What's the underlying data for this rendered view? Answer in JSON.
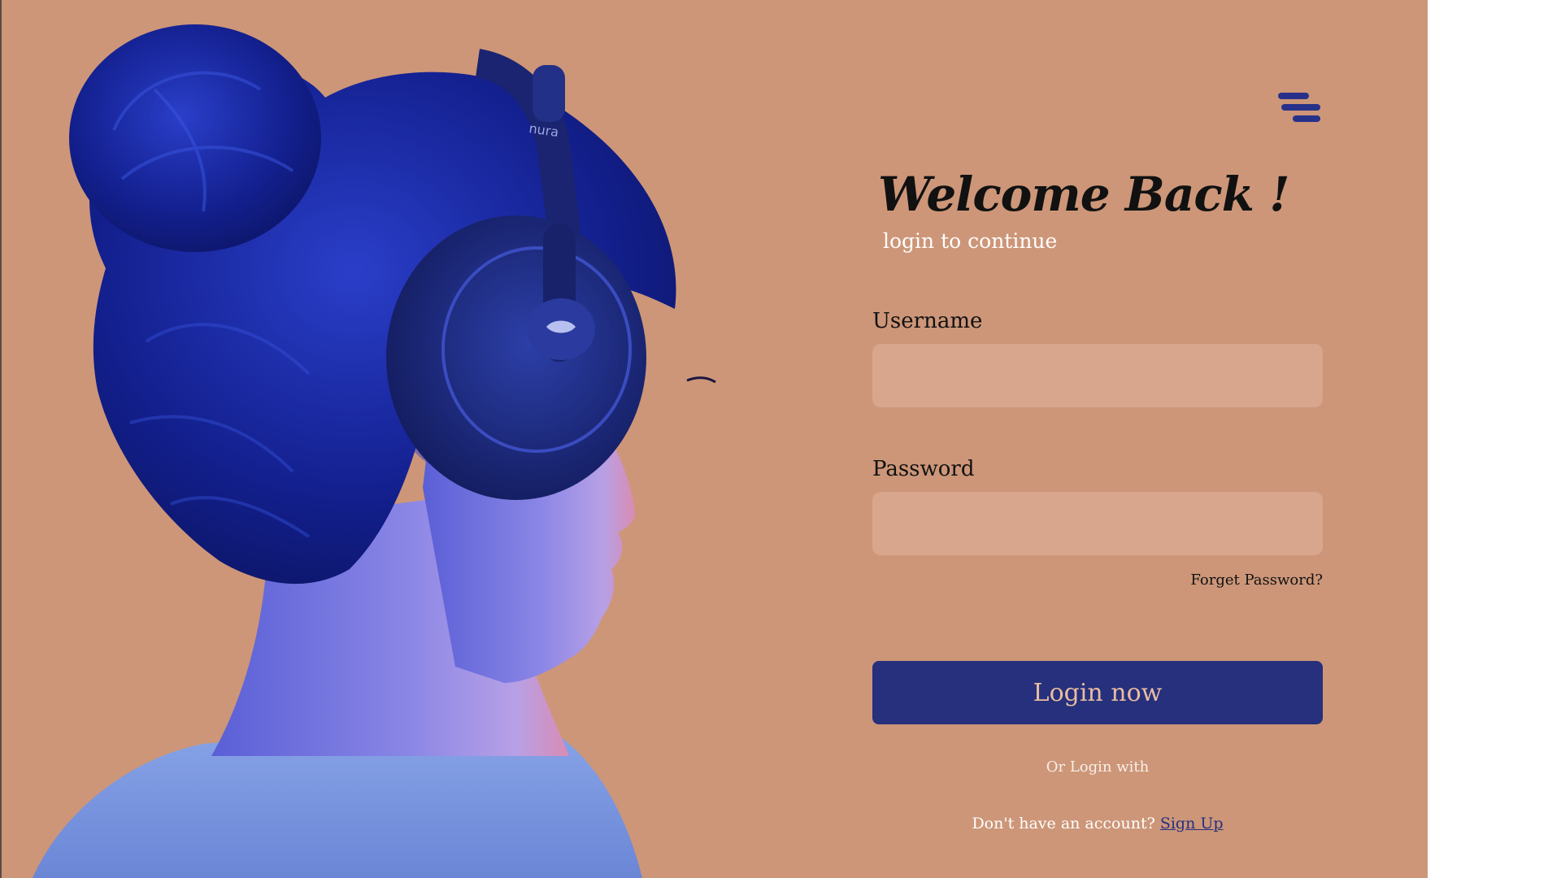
{
  "header": {
    "menu_icon": "hamburger-menu-icon"
  },
  "form": {
    "title": "Welcome Back !",
    "subtitle": "login to continue",
    "username_label": "Username",
    "username_value": "",
    "password_label": "Password",
    "password_value": "",
    "forgot_password": "Forget Password?",
    "login_button": "Login now",
    "alt_login_text": "Or Login with",
    "signup_prompt": "Don't have an account?",
    "signup_link": "Sign Up"
  },
  "hero": {
    "headphone_brand": "nura"
  },
  "colors": {
    "background": "#cd9678",
    "accent": "#26307c",
    "input_fill": "#d8a58d",
    "button_text": "#e9bca2"
  }
}
